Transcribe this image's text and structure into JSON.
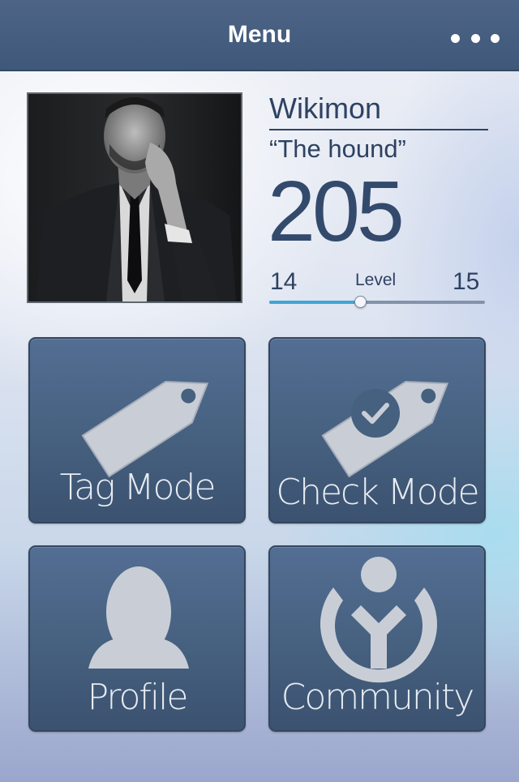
{
  "header": {
    "title": "Menu",
    "more_icon": "more-horizontal-icon"
  },
  "profile": {
    "username": "Wikimon",
    "nickname": "“The hound”",
    "score": "205",
    "level": {
      "label": "Level",
      "current": "14",
      "next": "15",
      "progress_percent": 42
    }
  },
  "tiles": [
    {
      "id": "tag-mode",
      "label": "Tag Mode",
      "icon": "tag-icon"
    },
    {
      "id": "check-mode",
      "label": "Check Mode",
      "icon": "tag-check-icon"
    },
    {
      "id": "profile",
      "label": "Profile",
      "icon": "person-icon"
    },
    {
      "id": "community",
      "label": "Community",
      "icon": "wikimedia-community-icon"
    }
  ],
  "colors": {
    "header_bg": "#46607f",
    "tile_bg": "#46607f",
    "text_dark": "#2e4262",
    "progress": "#3fa6d6"
  }
}
